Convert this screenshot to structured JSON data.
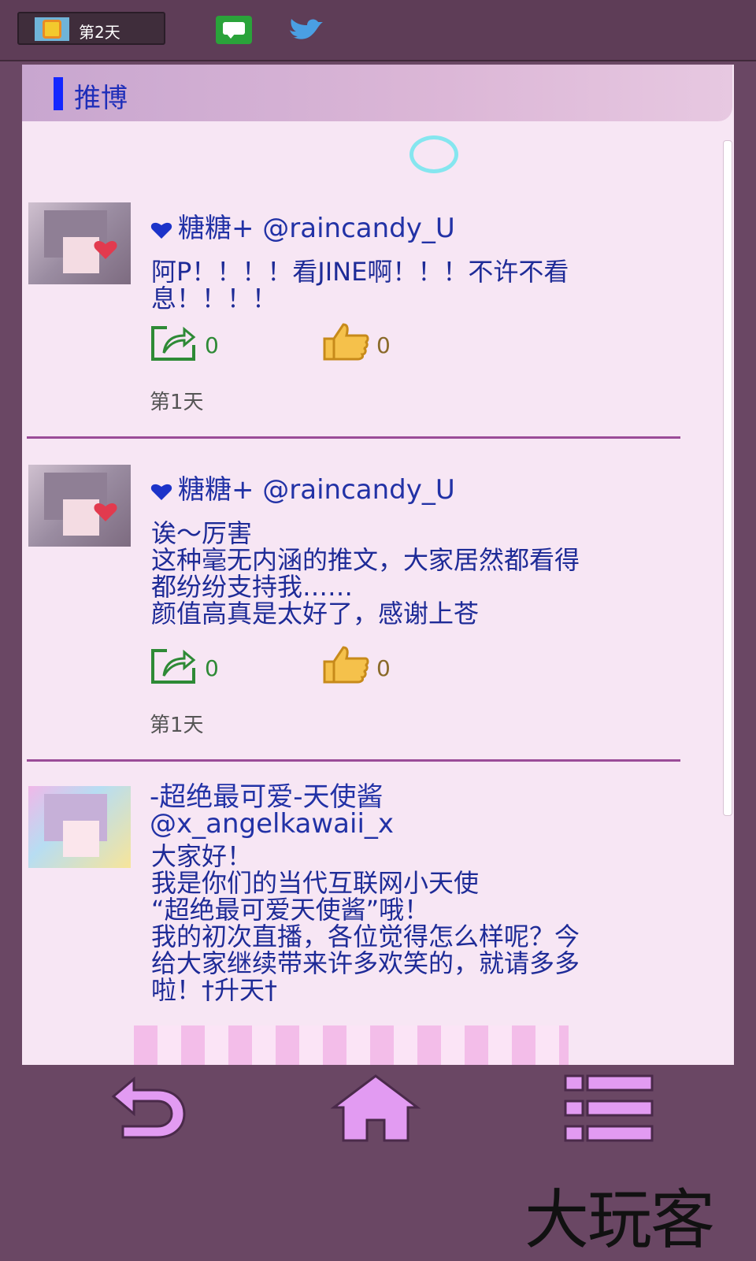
{
  "topbar": {
    "day_label": "第2天"
  },
  "section": {
    "title": "推博"
  },
  "posts": [
    {
      "author": "糖糖+ @raincandy_U",
      "text": "阿P！！！！看JINE啊！！！不许不看\n息！！！！",
      "shares": "0",
      "likes": "0",
      "time": "第1天"
    },
    {
      "author": "糖糖+ @raincandy_U",
      "text": "诶～厉害\n这种毫无内涵的推文，大家居然都看得\n都纷纷支持我……\n颜值高真是太好了，感谢上苍",
      "shares": "0",
      "likes": "0",
      "time": "第1天"
    },
    {
      "author_line1": "-超绝最可爱-天使酱",
      "author_line2": "@x_angelkawaii_x",
      "text": "大家好！\n我是你们的当代互联网小天使\n“超绝最可爱天使酱”哦！\n我的初次直播，各位觉得怎么样呢？今\n给大家继续带来许多欢笑的，就请多多\n啦！†升天†"
    }
  ],
  "watermark": "大玩客",
  "colors": {
    "frame": "#6a4764",
    "panel": "#f7e6f4",
    "accent_blue": "#1326ff",
    "text_blue": "#1e2b97",
    "divider": "#9b4c98",
    "nav_icon": "#e29bf2"
  },
  "icons": [
    "sun-icon",
    "jine-icon",
    "bird-icon",
    "heart-icon",
    "share-icon",
    "like-icon",
    "back-icon",
    "home-icon",
    "menu-icon"
  ]
}
